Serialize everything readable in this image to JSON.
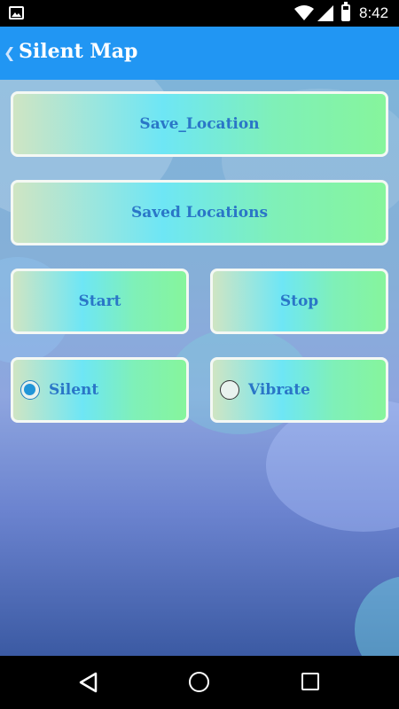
{
  "status_bar": {
    "time": "8:42",
    "icons": [
      "image-notification-icon",
      "wifi-icon",
      "signal-icon",
      "battery-icon"
    ]
  },
  "app_bar": {
    "back_glyph": "❮",
    "title": "Silent Map",
    "color": "#2196f3"
  },
  "buttons": {
    "save_location": "Save_Location",
    "saved_locations": "Saved Locations",
    "start": "Start",
    "stop": "Stop"
  },
  "ringer_mode": {
    "options": [
      {
        "label": "Silent",
        "checked": true
      },
      {
        "label": "Vibrate",
        "checked": false
      }
    ],
    "selected": "Silent"
  },
  "nav_bar": {
    "icons": [
      "back-icon",
      "home-icon",
      "recent-apps-icon"
    ]
  },
  "colors": {
    "button_text": "#2a76c7",
    "radio_selected": "#2196d8"
  }
}
